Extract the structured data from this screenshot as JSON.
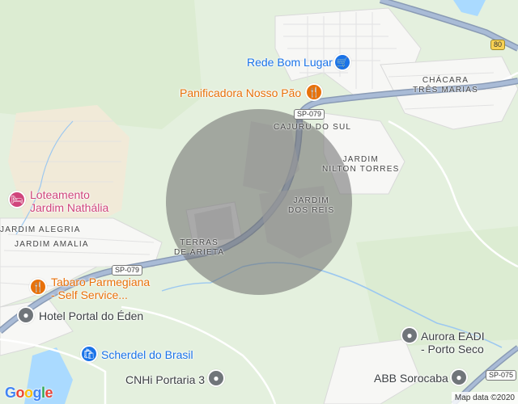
{
  "map": {
    "pois": [
      {
        "id": "rede-bom-lugar",
        "name": "Rede Bom Lugar",
        "color": "blue",
        "icon": "cart-icon"
      },
      {
        "id": "panificadora",
        "name": "Panificadora Nosso Pão",
        "color": "orange",
        "icon": "fork-knife-icon"
      },
      {
        "id": "loteamento",
        "name": "Loteamento\nJardim Nathália",
        "color": "pink",
        "icon": "bed-icon"
      },
      {
        "id": "tabaro",
        "name": "Tabaro Parmegiana\n- Self Service...",
        "color": "orange",
        "icon": "fork-knife-icon"
      },
      {
        "id": "hotel-eden",
        "name": "Hotel Portal do Éden",
        "color": "grey",
        "icon": "pin-icon"
      },
      {
        "id": "scherdel",
        "name": "Scherdel do Brasil",
        "color": "blue",
        "icon": "shopping-bag-icon"
      },
      {
        "id": "cnhi",
        "name": "CNHi Portaria 3",
        "color": "grey",
        "icon": "pin-icon"
      },
      {
        "id": "aurora",
        "name": "Aurora EADI\n- Porto Seco",
        "color": "grey",
        "icon": "pin-icon"
      },
      {
        "id": "abb",
        "name": "ABB Sorocaba",
        "color": "grey",
        "icon": "pin-icon"
      }
    ],
    "areas": {
      "chacara": "CHÁCARA\nTRÊS MARIAS",
      "cajuru": "CAJURU DO SUL",
      "nilton": "JARDIM\nNILTON TORRES",
      "dos_reis": "JARDIM\nDOS REIS",
      "terras": "TERRAS\nDE ARIETA",
      "alegria": "JARDIM ALEGRIA",
      "amalia": "JARDIM AMALIA"
    },
    "shields": {
      "sp079_top": "SP-079",
      "sp079_left": "SP-079",
      "sp075": "SP-075",
      "r80": "80"
    },
    "logo": "Google",
    "attribution": "Map data ©2020",
    "colors": {
      "water": "#aadaff",
      "road": "#8ab4f8",
      "highway": "#5b7fb0",
      "urban": "#ffffff",
      "park": "#e4f0de",
      "radius_fill": "#6b6b6b"
    }
  }
}
